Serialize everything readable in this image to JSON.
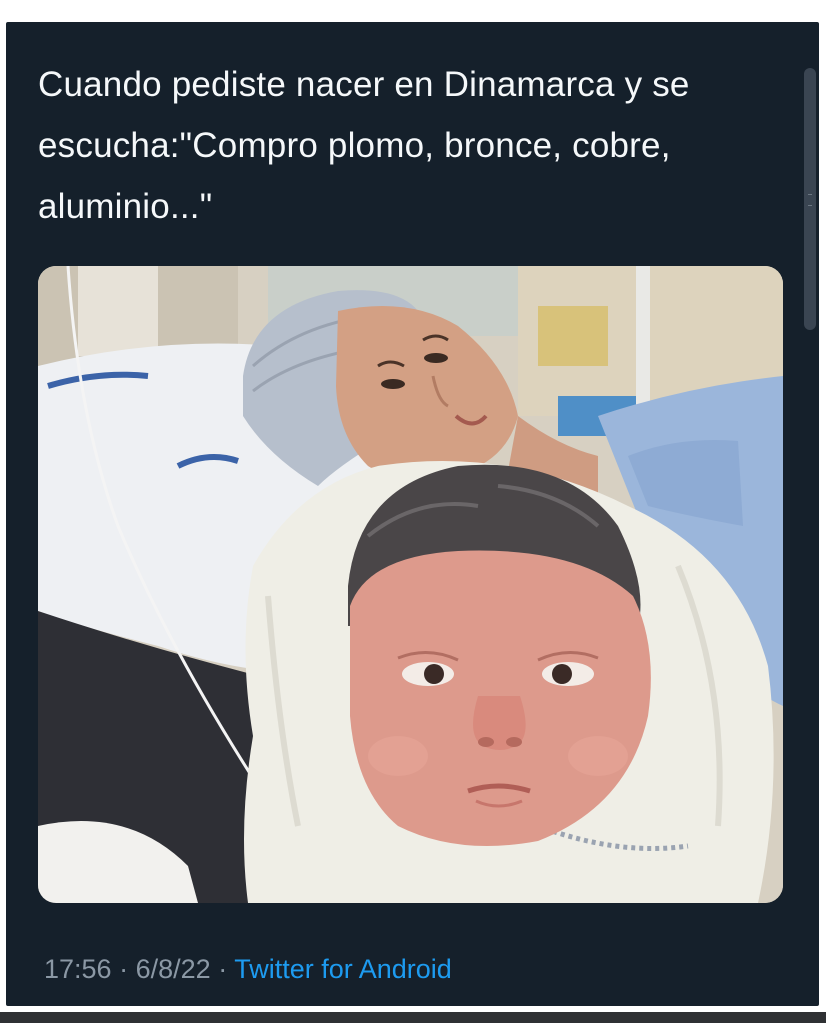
{
  "tweet": {
    "text": "Cuando pediste nacer en Dinamarca y se escucha:\"Compro plomo, bronce, cobre, aluminio...\"",
    "time": "17:56",
    "separator": "·",
    "date": "6/8/22",
    "source": "Twitter for Android"
  },
  "media": {
    "alt": ""
  },
  "colors": {
    "tweet_background": "#15202b",
    "text": "#f5f8fa",
    "meta_text": "#8b98a5",
    "link": "#1d9bf0"
  }
}
